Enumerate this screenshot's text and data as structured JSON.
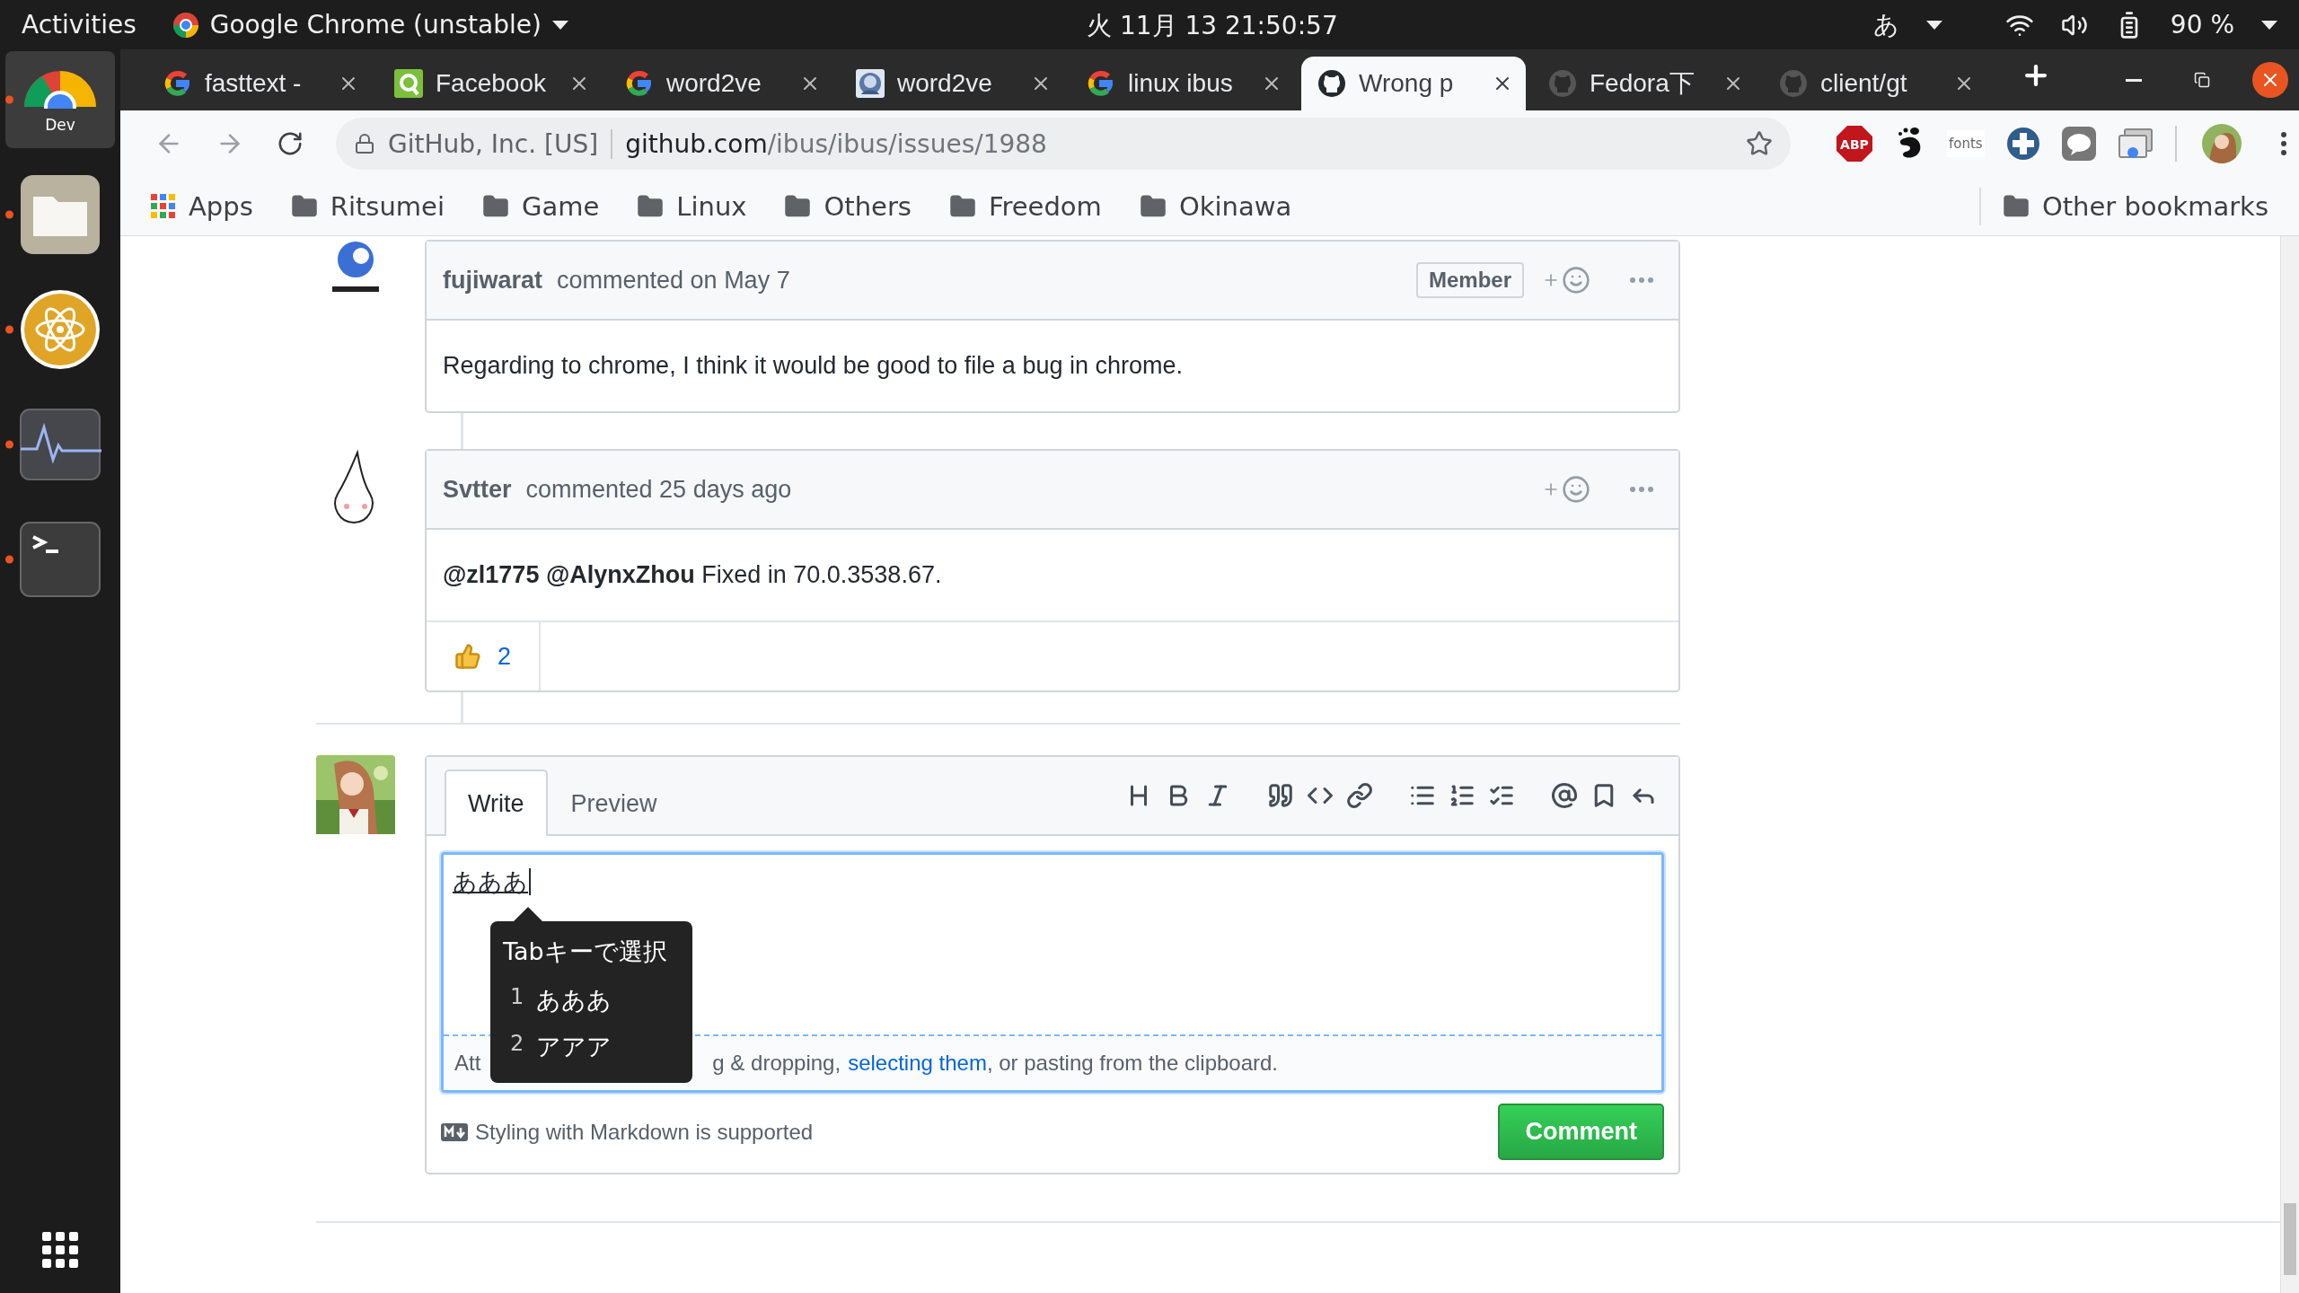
{
  "top_bar": {
    "activities": "Activities",
    "app_menu": "Google Chrome (unstable)",
    "clock": "火 11月 13  21:50:57",
    "input_method": "あ",
    "battery": "90 %"
  },
  "dock": [
    {
      "kind": "chrome",
      "label": "Dev",
      "running": true,
      "selected": true
    },
    {
      "kind": "files",
      "running": true,
      "selected": false
    },
    {
      "kind": "atom",
      "running": true,
      "selected": false
    },
    {
      "kind": "monitor",
      "running": true,
      "selected": false
    },
    {
      "kind": "terminal",
      "running": true,
      "selected": false
    }
  ],
  "tabs": [
    {
      "title": "fasttext -",
      "kind": "google",
      "selected": false
    },
    {
      "title": "Facebook",
      "kind": "green",
      "selected": false
    },
    {
      "title": "word2ve",
      "kind": "google",
      "selected": false
    },
    {
      "title": "word2ve",
      "kind": "picture",
      "selected": false
    },
    {
      "title": "linux ibus",
      "kind": "google",
      "selected": false
    },
    {
      "title": "Wrong p",
      "kind": "github",
      "selected": true
    },
    {
      "title": "Fedora下",
      "kind": "github",
      "selected": false
    },
    {
      "title": "client/gt",
      "kind": "github",
      "selected": false
    }
  ],
  "address_bar": {
    "site_identity": "GitHub, Inc. [US]",
    "host": "github.com",
    "path": "/ibus/ibus/issues/1988"
  },
  "extensions": [
    {
      "kind": "abp",
      "label": "ABP"
    },
    {
      "kind": "gnome"
    },
    {
      "kind": "fonts",
      "label": "fonts"
    },
    {
      "kind": "cross"
    },
    {
      "kind": "line"
    },
    {
      "kind": "cast"
    }
  ],
  "bookmarks": [
    {
      "kind": "apps",
      "label": "Apps"
    },
    {
      "kind": "folder",
      "label": "Ritsumei"
    },
    {
      "kind": "folder",
      "label": "Game"
    },
    {
      "kind": "folder",
      "label": "Linux"
    },
    {
      "kind": "folder",
      "label": "Others"
    },
    {
      "kind": "folder",
      "label": "Freedom"
    },
    {
      "kind": "folder",
      "label": "Okinawa"
    }
  ],
  "other_bookmarks": "Other bookmarks",
  "comments": [
    {
      "kind": "gnome",
      "author": "fujiwarat",
      "meta": "commented on May 7",
      "badge": "Member",
      "body": "Regarding to chrome, I think it would be good to file a bug in chrome."
    },
    {
      "kind": "figure",
      "author": "Svtter",
      "meta": "commented 25 days ago",
      "body": "**@zl1775 @AlynxZhou** Fixed in 70.0.3538.67.",
      "reactions": [
        {
          "count": "2"
        }
      ]
    }
  ],
  "editor": {
    "tabs": [
      {
        "label": "Write",
        "selected": true
      },
      {
        "label": "Preview",
        "selected": false
      }
    ],
    "value": "あああ",
    "ime": {
      "title": "Tabキーで選択",
      "candidates": [
        {
          "number": "1",
          "text": "あああ"
        },
        {
          "number": "2",
          "text": "アアア"
        }
      ]
    },
    "hint_start": "Att",
    "hint_rest": "g & dropping,",
    "hint_link": "selecting them",
    "hint_end": ", or pasting from the clipboard.",
    "markdown_note": "Styling with Markdown is supported",
    "submit": "Comment"
  }
}
